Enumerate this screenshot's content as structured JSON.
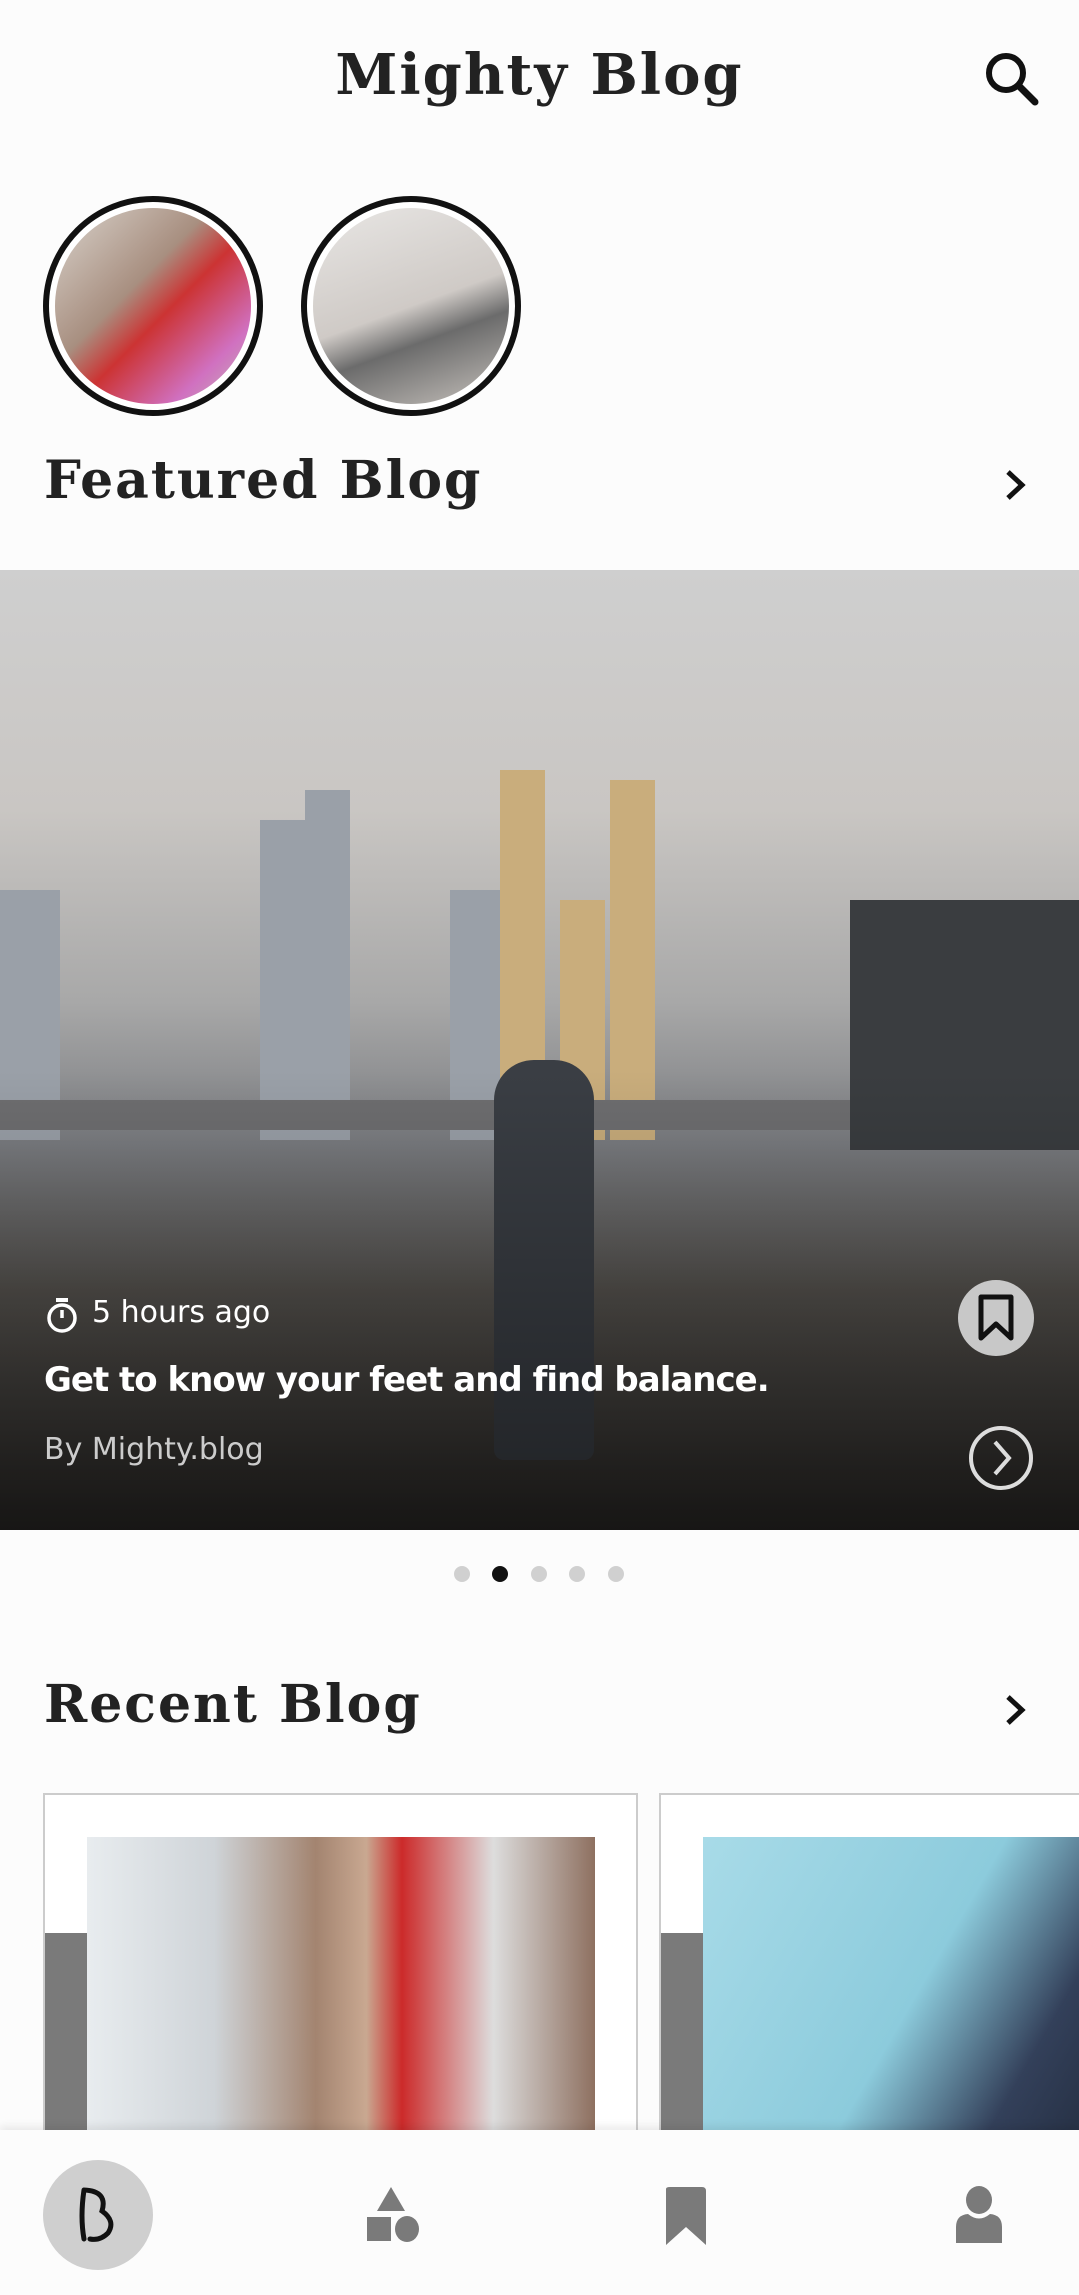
{
  "header": {
    "title": "Mighty Blog",
    "search_icon": "search-icon"
  },
  "stories": [
    {
      "label": "yoga-story-1"
    },
    {
      "label": "yoga-story-2"
    }
  ],
  "featured": {
    "heading": "Featured Blog",
    "post": {
      "time": "5 hours ago",
      "title": "Get to know your feet and find balance.",
      "author": "By Mighty.blog"
    },
    "carousel": {
      "count": 5,
      "active_index": 1
    }
  },
  "recent": {
    "heading": "Recent Blog"
  },
  "nav": {
    "items": [
      "home",
      "categories",
      "bookmarks",
      "profile"
    ],
    "active": "home"
  },
  "colors": {
    "text": "#222222",
    "active_nav_bg": "#cfcfcf",
    "nav_icon": "#7a7a7a",
    "dot_active": "#111111",
    "dot_inactive": "#d0d0d0"
  }
}
